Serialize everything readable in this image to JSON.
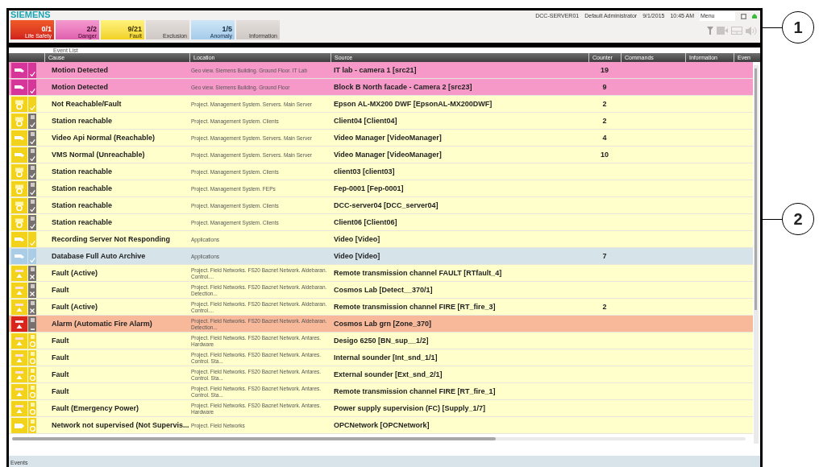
{
  "header": {
    "logo": "SIEMENS",
    "server": "DCC-SERVER01",
    "user": "Default Administrator",
    "date": "9/1/2015",
    "time": "10:45 AM",
    "menu": "Menu"
  },
  "summary": [
    {
      "kind": "lifesafety",
      "count": "0/1",
      "label": "Life Safety"
    },
    {
      "kind": "danger",
      "count": "2/2",
      "label": "Danger"
    },
    {
      "kind": "fault",
      "count": "9/21",
      "label": "Fault"
    },
    {
      "kind": "neutral",
      "label": "Exclusion"
    },
    {
      "kind": "anomaly",
      "count": "1/5",
      "label": "Anomaly"
    },
    {
      "kind": "neutral",
      "label": "Information"
    }
  ],
  "event_list": {
    "title": "Event List",
    "columns": [
      "Cause",
      "Location",
      "Source",
      "Counter",
      "Commands",
      "Information",
      "Even"
    ],
    "rows": [
      {
        "kind": "camera-check",
        "color": "#f799c8",
        "cause": "Motion Detected",
        "location": "Geo view. Siemens Building. Ground Floor. IT Lab",
        "source": "IT lab - camera 1 [src21]",
        "counter": "19"
      },
      {
        "kind": "camera-check",
        "color": "#f799c8",
        "cause": "Motion Detected",
        "location": "Geo view. Siemens Building. Ground Floor",
        "source": "Block B North facade - Camera 2 [src23]",
        "counter": "9"
      },
      {
        "kind": "station-check",
        "color": "#ffffcc",
        "cause": "Not Reachable/Fault",
        "location": "Project. Management System. Servers. Main Server",
        "source": "Epson AL-MX200 DWF [EpsonAL-MX200DWF]",
        "counter": "2"
      },
      {
        "kind": "station-graycheck",
        "color": "#ffffcc",
        "cause": "Station reachable",
        "location": "Project. Management System. Clients",
        "source": "Client04 [Client04]",
        "counter": "2"
      },
      {
        "kind": "camera-graycheck",
        "color": "#ffffcc",
        "cause": "Video Api Normal (Reachable)",
        "location": "Project. Management System. Servers. Main Server",
        "source": "Video Manager [VideoManager]",
        "counter": "4"
      },
      {
        "kind": "camera-graycheck",
        "color": "#ffffcc",
        "cause": "VMS Normal (Unreachable)",
        "location": "Project. Management System. Servers. Main Server",
        "source": "Video Manager [VideoManager]",
        "counter": "10"
      },
      {
        "kind": "station-graycheck",
        "color": "#ffffcc",
        "cause": "Station reachable",
        "location": "Project. Management System. Clients",
        "source": "client03 [client03]"
      },
      {
        "kind": "station-graycheck",
        "color": "#ffffcc",
        "cause": "Station reachable",
        "location": "Project. Management System. FEPs",
        "source": "Fep-0001 [Fep-0001]"
      },
      {
        "kind": "station-graycheck",
        "color": "#ffffcc",
        "cause": "Station reachable",
        "location": "Project. Management System. Clients",
        "source": "DCC-server04 [DCC_server04]"
      },
      {
        "kind": "station-graycheck",
        "color": "#ffffcc",
        "cause": "Station reachable",
        "location": "Project. Management System. Clients",
        "source": "Client06 [Client06]"
      },
      {
        "kind": "camera-check",
        "color": "#ffffcc",
        "cause": "Recording Server Not Responding",
        "location": "Applications",
        "source": "Video [Video]"
      },
      {
        "kind": "camera-check",
        "color": "#d6e4ea",
        "cause": "Database Full Auto Archive",
        "location": "Applications",
        "source": "Video [Video]",
        "counter": "7"
      },
      {
        "kind": "triangle-cross",
        "color": "#ffffcc",
        "cause": "Fault (Active)",
        "location": "Project. Field Networks. FS20 Bacnet Network. Aldebaran. Control....",
        "source": "Remote transmission channel FAULT [RTfault_4]"
      },
      {
        "kind": "triangle-cross",
        "color": "#ffffcc",
        "cause": "Fault",
        "location": "Project. Field Networks. FS20 Bacnet Network. Aldebaran. Detection...",
        "source": "Cosmos Lab [Detect__370/1]"
      },
      {
        "kind": "triangle-cross",
        "color": "#ffffcc",
        "cause": "Fault (Active)",
        "location": "Project. Field Networks. FS20 Bacnet Network. Aldebaran. Control....",
        "source": "Remote transmission channel FIRE [RT_fire_3]",
        "counter": "2"
      },
      {
        "kind": "triangle-dash",
        "color": "#f8b89a",
        "cause": "Alarm (Automatic Fire Alarm)",
        "location": "Project. Field Networks. FS20 Bacnet Network. Aldebaran. Detection...",
        "source": "Cosmos Lab grn [Zone_370]"
      },
      {
        "kind": "triangle-circle",
        "color": "#ffffcc",
        "cause": "Fault",
        "location": "Project. Field Networks. FS20 Bacnet Network. Antares. Hardware",
        "source": "Desigo 6250 [BN_sup__1/2]"
      },
      {
        "kind": "triangle-circle",
        "color": "#ffffcc",
        "cause": "Fault",
        "location": "Project. Field Networks. FS20 Bacnet Network. Antares. Control. Sta...",
        "source": "Internal sounder [Int_snd_1/1]"
      },
      {
        "kind": "triangle-circle",
        "color": "#ffffcc",
        "cause": "Fault",
        "location": "Project. Field Networks. FS20 Bacnet Network. Antares. Control. Sta...",
        "source": "External sounder [Ext_snd_2/1]"
      },
      {
        "kind": "triangle-circle",
        "color": "#ffffcc",
        "cause": "Fault",
        "location": "Project. Field Networks. FS20 Bacnet Network. Antares. Control. Sta...",
        "source": "Remote transmission channel FIRE [RT_fire_1]"
      },
      {
        "kind": "triangle-circle",
        "color": "#ffffcc",
        "cause": "Fault (Emergency Power)",
        "location": "Project. Field Networks. FS20 Bacnet Network. Antares. Hardware",
        "source": "Power supply supervision (FC) [Supply_1/7]"
      },
      {
        "kind": "network-circle",
        "color": "#ffffcc",
        "cause": "Network not supervised (Not Supervis...",
        "location": "Project. Field Networks",
        "source": "OPCNetwork [OPCNetwork]"
      }
    ],
    "status_bar": "Events"
  },
  "callouts": [
    "1",
    "2"
  ]
}
